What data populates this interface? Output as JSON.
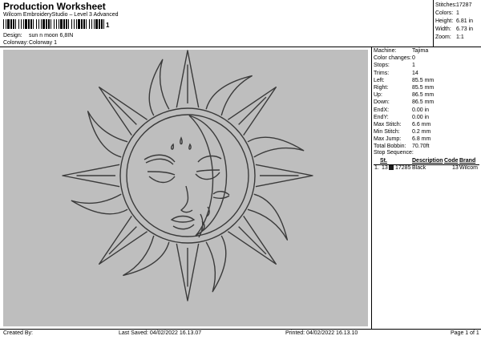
{
  "header": {
    "title": "Production Worksheet",
    "subtitle": "Wilcom EmbroideryStudio – Level 3 Advanced",
    "barcode_text": "1"
  },
  "meta": [
    {
      "label": "Design:",
      "value": "sun n moon 6,8IN"
    },
    {
      "label": "Colorway:",
      "value": "Colorway 1"
    }
  ],
  "stats": [
    {
      "label": "Stitches:",
      "value": "17287"
    },
    {
      "label": "Colors:",
      "value": "1"
    },
    {
      "label": "Height:",
      "value": "6.81 in"
    },
    {
      "label": "Width:",
      "value": "6.73 in"
    },
    {
      "label": "Zoom:",
      "value": "1:1"
    }
  ],
  "details": [
    {
      "label": "Machine:",
      "value": "Tajima"
    },
    {
      "label": "Color changes:",
      "value": "0"
    },
    {
      "label": "Stops:",
      "value": "1"
    },
    {
      "label": "Trims:",
      "value": "14"
    },
    {
      "label": "Left:",
      "value": "85.5 mm"
    },
    {
      "label": "Right:",
      "value": "85.5 mm"
    },
    {
      "label": "Up:",
      "value": "86.5 mm"
    },
    {
      "label": "Down:",
      "value": "86.5 mm"
    },
    {
      "label": "EndX:",
      "value": "0.00 in"
    },
    {
      "label": "EndY:",
      "value": "0.00 in"
    },
    {
      "label": "Max Stitch:",
      "value": "6.6 mm"
    },
    {
      "label": "Min Stitch:",
      "value": "0.2 mm"
    },
    {
      "label": "Max Jump:",
      "value": "6.8 mm"
    },
    {
      "label": "Total Bobbin:",
      "value": "70.70ft"
    }
  ],
  "stop_sequence": {
    "title": "Stop Sequence:",
    "headers": {
      "st": "St.",
      "description": "Description",
      "code": "Code",
      "brand": "Brand"
    },
    "rows": [
      {
        "index": "1.",
        "stop": "13",
        "swatch": "#1a1a1a",
        "st": "17285",
        "description": "Black",
        "code": "13",
        "brand": "Wilcom"
      }
    ]
  },
  "footer": {
    "created": "Created By:",
    "saved": "Last Saved: 04/02/2022 16.13.07",
    "printed": "Printed: 04/02/2022 16.13.10",
    "page": "Page 1 of 1"
  },
  "colors": {
    "design_bg": "#bebebe",
    "stroke": "#3a3a3a"
  }
}
